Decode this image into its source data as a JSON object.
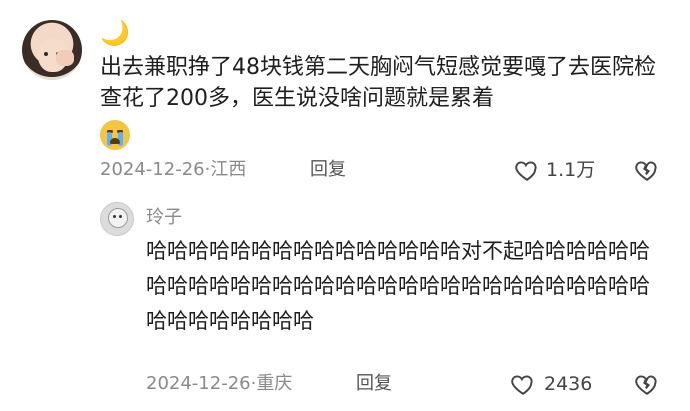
{
  "comment": {
    "username": "🌙",
    "text": "出去兼职挣了48块钱第二天胸闷气短感觉要嘎了去医院检查花了200多，医生说没啥问题就是累着",
    "emoji": "loudly-crying-face",
    "date": "2024-12-26",
    "location": "江西",
    "reply_label": "回复",
    "like_count": "1.1万"
  },
  "reply": {
    "username": "玲子",
    "text": "哈哈哈哈哈哈哈哈哈哈哈哈哈哈哈对不起哈哈哈哈哈哈哈哈哈哈哈哈哈哈哈哈哈哈哈哈哈哈哈哈哈哈哈哈哈哈哈哈哈哈哈哈哈哈",
    "date": "2024-12-26",
    "location": "重庆",
    "reply_label": "回复",
    "like_count": "2436"
  },
  "icons": {
    "like": "heart-outline-icon",
    "dislike": "broken-heart-icon"
  },
  "colors": {
    "text": "#1e1e1e",
    "meta": "#8a8a8a",
    "moon": "#e0b53c"
  }
}
